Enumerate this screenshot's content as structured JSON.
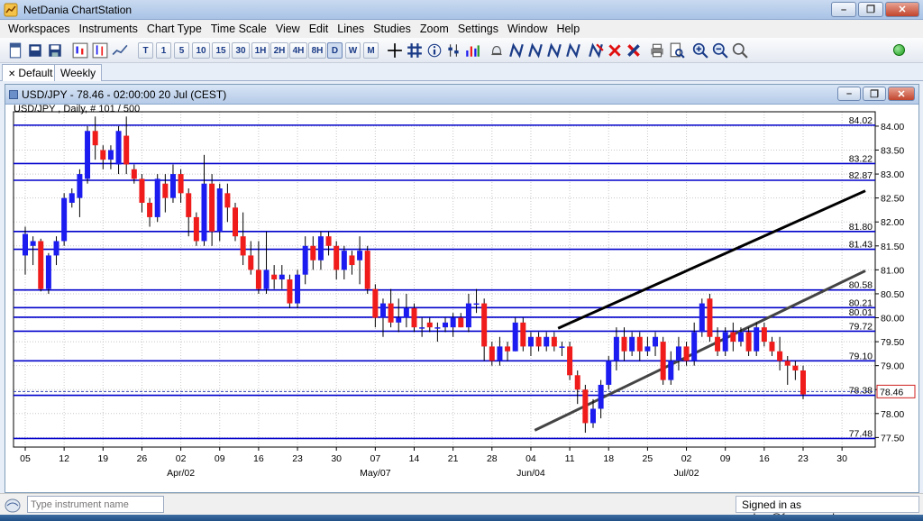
{
  "app": {
    "title": "NetDania ChartStation",
    "window_controls": {
      "minimize": "–",
      "restore": "❐",
      "close": "✕"
    }
  },
  "menu": [
    "Workspaces",
    "Instruments",
    "Chart Type",
    "Time Scale",
    "View",
    "Edit",
    "Lines",
    "Studies",
    "Zoom",
    "Settings",
    "Window",
    "Help"
  ],
  "toolbar": {
    "timeframes": [
      "T",
      "1",
      "5",
      "10",
      "15",
      "30",
      "1H",
      "2H",
      "4H",
      "8H",
      "D",
      "W",
      "M"
    ],
    "active_timeframe": "D"
  },
  "tabs": [
    {
      "label": "Default",
      "active": true
    },
    {
      "label": "Weekly",
      "active": false
    }
  ],
  "chart_window": {
    "title": "USD/JPY - 78.46 - 02:00:00  20 Jul (CEST)",
    "subtitle": "USD/JPY , Daily, # 101 / 500"
  },
  "colors": {
    "up": "#1c1cf0",
    "down": "#f01c1c",
    "hline": "#0000cc",
    "grid": "#c8c8c8",
    "trend_dark": "#000000",
    "trend_gray": "#444444",
    "price_marker_bg": "#ffffff"
  },
  "chart_data": {
    "type": "candlestick",
    "symbol": "USD/JPY",
    "ylim": [
      77.3,
      84.3
    ],
    "y_ticks": [
      77.5,
      78.0,
      78.5,
      79.0,
      79.5,
      80.0,
      80.5,
      81.0,
      81.5,
      82.0,
      82.5,
      83.0,
      83.5,
      84.0
    ],
    "y_tick_labels": [
      "77.50",
      "78.00",
      "78.50",
      "79.00",
      "79.50",
      "80.00",
      "80.50",
      "81.00",
      "81.50",
      "82.00",
      "82.50",
      "83.00",
      "83.50",
      "84.00"
    ],
    "x_ticks": [
      {
        "label": "05",
        "idx": 0
      },
      {
        "label": "12",
        "idx": 5
      },
      {
        "label": "19",
        "idx": 10
      },
      {
        "label": "26",
        "idx": 15
      },
      {
        "label": "02",
        "idx": 20
      },
      {
        "label": "09",
        "idx": 25
      },
      {
        "label": "16",
        "idx": 30
      },
      {
        "label": "23",
        "idx": 35
      },
      {
        "label": "30",
        "idx": 40
      },
      {
        "label": "07",
        "idx": 45
      },
      {
        "label": "14",
        "idx": 50
      },
      {
        "label": "21",
        "idx": 55
      },
      {
        "label": "28",
        "idx": 60
      },
      {
        "label": "04",
        "idx": 65
      },
      {
        "label": "11",
        "idx": 70
      },
      {
        "label": "18",
        "idx": 75
      },
      {
        "label": "25",
        "idx": 80
      },
      {
        "label": "02",
        "idx": 85
      },
      {
        "label": "09",
        "idx": 90
      },
      {
        "label": "16",
        "idx": 95
      },
      {
        "label": "23",
        "idx": 100
      },
      {
        "label": "30",
        "idx": 105
      }
    ],
    "month_labels": [
      {
        "label": "Apr/02",
        "idx": 20
      },
      {
        "label": "May/07",
        "idx": 45
      },
      {
        "label": "Jun/04",
        "idx": 65
      },
      {
        "label": "Jul/02",
        "idx": 85
      }
    ],
    "horizontal_levels": [
      {
        "value": 84.02,
        "label": "84.02"
      },
      {
        "value": 83.22,
        "label": "83.22"
      },
      {
        "value": 82.87,
        "label": "82.87"
      },
      {
        "value": 81.8,
        "label": "81.80"
      },
      {
        "value": 81.43,
        "label": "81.43"
      },
      {
        "value": 80.58,
        "label": "80.58"
      },
      {
        "value": 80.21,
        "label": "80.21"
      },
      {
        "value": 80.01,
        "label": "80.01"
      },
      {
        "value": 79.72,
        "label": "79.72"
      },
      {
        "value": 79.1,
        "label": "79.10"
      },
      {
        "value": 78.38,
        "label": "78.38"
      },
      {
        "value": 77.48,
        "label": "77.48"
      }
    ],
    "current_price": {
      "value": 78.46,
      "label": "78.46"
    },
    "trendlines": [
      {
        "from": [
          68.5,
          79.78
        ],
        "to": [
          108,
          82.65
        ],
        "color": "dark"
      },
      {
        "from": [
          65.5,
          77.65
        ],
        "to": [
          108,
          80.98
        ],
        "color": "gray"
      }
    ],
    "candles": [
      [
        81.3,
        81.75,
        80.9,
        81.9
      ],
      [
        81.5,
        81.6,
        81.1,
        81.7
      ],
      [
        81.6,
        80.6,
        80.55,
        81.65
      ],
      [
        80.6,
        81.3,
        80.5,
        81.35
      ],
      [
        81.3,
        81.6,
        81.1,
        81.7
      ],
      [
        81.6,
        82.5,
        81.5,
        82.6
      ],
      [
        82.4,
        82.6,
        82.3,
        82.7
      ],
      [
        82.5,
        83.0,
        82.1,
        83.1
      ],
      [
        82.9,
        83.9,
        82.8,
        84.0
      ],
      [
        83.9,
        83.6,
        83.3,
        84.2
      ],
      [
        83.5,
        83.3,
        83.1,
        83.6
      ],
      [
        83.3,
        83.5,
        83.1,
        83.6
      ],
      [
        83.2,
        83.9,
        83.0,
        84.0
      ],
      [
        83.8,
        83.2,
        83.0,
        84.2
      ],
      [
        83.1,
        82.9,
        82.8,
        83.2
      ],
      [
        82.9,
        82.4,
        82.2,
        83.0
      ],
      [
        82.4,
        82.1,
        81.9,
        82.5
      ],
      [
        82.1,
        82.9,
        82.0,
        83.0
      ],
      [
        82.8,
        82.5,
        82.2,
        83.0
      ],
      [
        82.5,
        83.0,
        82.4,
        83.2
      ],
      [
        83.0,
        82.6,
        82.4,
        83.1
      ],
      [
        82.6,
        82.1,
        81.7,
        82.7
      ],
      [
        82.1,
        81.6,
        81.5,
        82.2
      ],
      [
        81.6,
        82.8,
        81.5,
        83.4
      ],
      [
        82.8,
        81.8,
        81.5,
        83.0
      ],
      [
        81.8,
        82.7,
        81.6,
        82.8
      ],
      [
        82.6,
        82.3,
        82.0,
        82.8
      ],
      [
        82.3,
        81.7,
        81.6,
        82.4
      ],
      [
        81.7,
        81.3,
        81.1,
        82.2
      ],
      [
        81.3,
        81.0,
        80.9,
        81.6
      ],
      [
        81.0,
        80.6,
        80.5,
        81.6
      ],
      [
        80.6,
        81.0,
        80.5,
        81.8
      ],
      [
        80.9,
        80.8,
        80.6,
        81.1
      ],
      [
        80.8,
        80.9,
        80.6,
        81.1
      ],
      [
        80.8,
        80.3,
        80.2,
        80.9
      ],
      [
        80.3,
        80.9,
        80.2,
        81.0
      ],
      [
        80.9,
        81.5,
        80.7,
        81.7
      ],
      [
        81.5,
        81.2,
        81.0,
        81.7
      ],
      [
        81.2,
        81.7,
        81.0,
        81.8
      ],
      [
        81.7,
        81.5,
        81.3,
        81.8
      ],
      [
        81.5,
        81.0,
        80.8,
        81.6
      ],
      [
        81.0,
        81.4,
        80.8,
        81.5
      ],
      [
        81.3,
        81.1,
        80.9,
        81.4
      ],
      [
        81.2,
        81.4,
        80.7,
        81.7
      ],
      [
        81.4,
        80.6,
        80.5,
        81.5
      ],
      [
        80.6,
        80.0,
        79.8,
        80.7
      ],
      [
        80.0,
        80.3,
        79.6,
        80.4
      ],
      [
        80.3,
        79.9,
        79.8,
        80.6
      ],
      [
        79.9,
        80.0,
        79.7,
        80.4
      ],
      [
        80.0,
        80.2,
        79.8,
        80.5
      ],
      [
        80.2,
        79.8,
        79.7,
        80.3
      ],
      [
        79.8,
        79.8,
        79.6,
        80.0
      ],
      [
        79.9,
        79.8,
        79.7,
        80.0
      ],
      [
        79.8,
        79.8,
        79.5,
        79.9
      ],
      [
        79.8,
        79.9,
        79.7,
        80.0
      ],
      [
        79.8,
        80.0,
        79.6,
        80.1
      ],
      [
        80.0,
        79.8,
        79.8,
        80.1
      ],
      [
        79.8,
        80.3,
        79.7,
        80.5
      ],
      [
        80.3,
        80.3,
        80.1,
        80.6
      ],
      [
        80.3,
        79.4,
        79.1,
        80.4
      ],
      [
        79.4,
        79.1,
        79.0,
        79.5
      ],
      [
        79.1,
        79.4,
        79.0,
        79.6
      ],
      [
        79.4,
        79.3,
        79.1,
        79.5
      ],
      [
        79.3,
        79.9,
        79.3,
        80.0
      ],
      [
        79.9,
        79.4,
        79.3,
        80.0
      ],
      [
        79.4,
        79.6,
        79.2,
        79.7
      ],
      [
        79.6,
        79.4,
        79.3,
        79.7
      ],
      [
        79.4,
        79.6,
        79.3,
        79.7
      ],
      [
        79.6,
        79.4,
        79.3,
        79.7
      ],
      [
        79.4,
        79.4,
        79.2,
        79.5
      ],
      [
        79.4,
        78.8,
        78.7,
        79.5
      ],
      [
        78.8,
        78.5,
        78.2,
        78.9
      ],
      [
        78.5,
        77.8,
        77.6,
        78.6
      ],
      [
        77.8,
        78.1,
        77.7,
        78.3
      ],
      [
        78.1,
        78.6,
        77.9,
        78.7
      ],
      [
        78.6,
        79.1,
        78.5,
        79.2
      ],
      [
        79.1,
        79.6,
        78.9,
        79.8
      ],
      [
        79.6,
        79.3,
        79.1,
        79.8
      ],
      [
        79.3,
        79.6,
        79.2,
        79.7
      ],
      [
        79.6,
        79.3,
        79.1,
        79.7
      ],
      [
        79.3,
        79.4,
        79.2,
        79.6
      ],
      [
        79.4,
        79.6,
        79.2,
        79.7
      ],
      [
        79.5,
        78.7,
        78.6,
        79.6
      ],
      [
        78.7,
        79.1,
        78.6,
        79.3
      ],
      [
        79.1,
        79.4,
        78.9,
        79.6
      ],
      [
        79.4,
        79.1,
        79.0,
        79.5
      ],
      [
        79.1,
        79.7,
        79.0,
        79.9
      ],
      [
        79.7,
        80.3,
        79.6,
        80.4
      ],
      [
        80.4,
        79.6,
        79.5,
        80.5
      ],
      [
        79.6,
        79.3,
        79.2,
        79.8
      ],
      [
        79.3,
        79.7,
        79.2,
        79.8
      ],
      [
        79.7,
        79.5,
        79.3,
        79.9
      ],
      [
        79.5,
        79.7,
        79.4,
        79.8
      ],
      [
        79.7,
        79.3,
        79.2,
        79.8
      ],
      [
        79.3,
        79.8,
        79.2,
        79.9
      ],
      [
        79.8,
        79.5,
        79.4,
        79.9
      ],
      [
        79.5,
        79.3,
        79.2,
        79.6
      ],
      [
        79.3,
        79.1,
        78.9,
        79.6
      ],
      [
        79.1,
        79.0,
        78.6,
        79.2
      ],
      [
        79.0,
        78.9,
        78.7,
        79.1
      ],
      [
        78.9,
        78.4,
        78.3,
        79.0
      ]
    ]
  }
}
